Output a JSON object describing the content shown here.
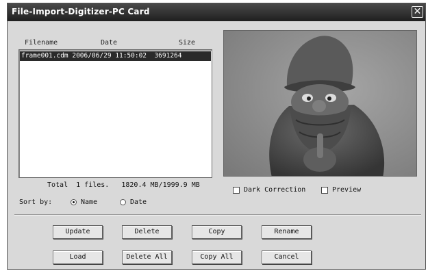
{
  "window": {
    "title": "File-Import-Digitizer-PC Card",
    "close_glyph": "✕"
  },
  "filelist": {
    "headers": {
      "filename": "Filename",
      "date": "Date",
      "size": "Size"
    },
    "rows": [
      {
        "text": "frame001.cdm 2006/06/29 11:50:02  3691264"
      }
    ]
  },
  "summary": {
    "total_text": "Total  1 files.   1820.4 MB/1999.9 MB"
  },
  "options": {
    "dark_correction": {
      "label": "Dark Correction",
      "checked": false
    },
    "preview": {
      "label": "Preview",
      "checked": false
    }
  },
  "sort": {
    "label": "Sort by:",
    "options": [
      {
        "label": "Name",
        "selected": true
      },
      {
        "label": "Date",
        "selected": false
      }
    ]
  },
  "buttons": {
    "update": "Update",
    "delete": "Delete",
    "copy": "Copy",
    "rename": "Rename",
    "load": "Load",
    "delete_all": "Delete All",
    "copy_all": "Copy All",
    "cancel": "Cancel"
  },
  "preview_image": {
    "subject": "garden gnome figurine photo"
  }
}
